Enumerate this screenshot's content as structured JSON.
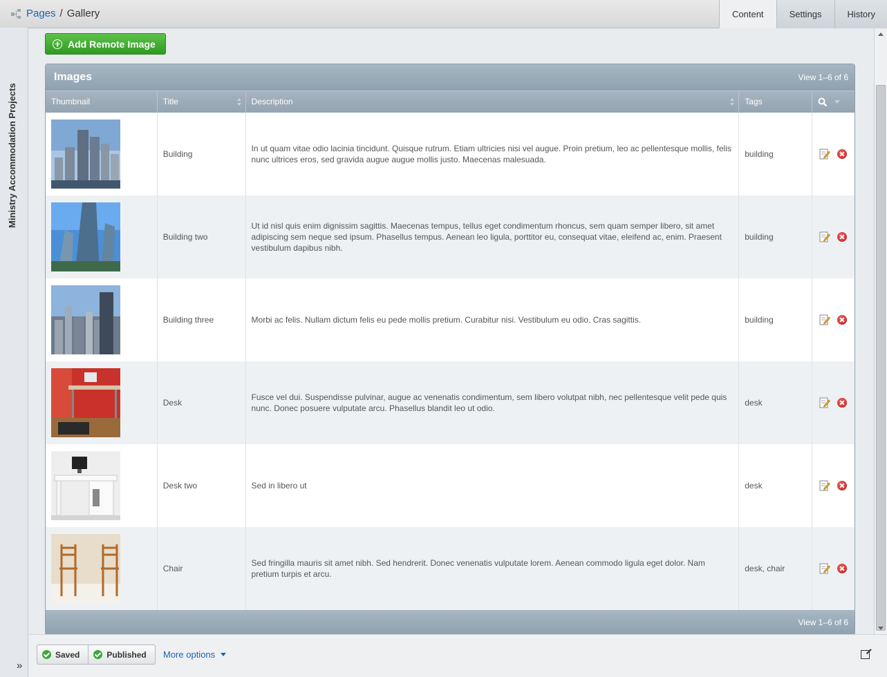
{
  "breadcrumb": {
    "root": "Pages",
    "separator": "/",
    "current": "Gallery"
  },
  "tabs": [
    {
      "label": "Content",
      "active": true
    },
    {
      "label": "Settings",
      "active": false
    },
    {
      "label": "History",
      "active": false
    }
  ],
  "sidebar": {
    "title": "Ministry Accommodation Projects",
    "expand_label": "»"
  },
  "toolbar": {
    "add_label": "Add Remote Image"
  },
  "grid": {
    "title": "Images",
    "view_top": "View 1–6 of 6",
    "view_bottom": "View 1–6 of 6",
    "columns": [
      "Thumbnail",
      "Title",
      "Description",
      "Tags"
    ],
    "rows": [
      {
        "title": "Building",
        "description": "In ut quam vitae odio lacinia tincidunt. Quisque rutrum. Etiam ultricies nisi vel augue. Proin pretium, leo ac pellentesque mollis, felis nunc ultrices eros, sed gravida augue augue mollis justo. Maecenas malesuada.",
        "tags": "building",
        "thumb": "skyscrapers"
      },
      {
        "title": "Building two",
        "description": "Ut id nisl quis enim dignissim sagittis. Maecenas tempus, tellus eget condimentum rhoncus, sem quam semper libero, sit amet adipiscing sem neque sed ipsum. Phasellus tempus. Aenean leo ligula, porttitor eu, consequat vitae, eleifend ac, enim. Praesent vestibulum dapibus nibh.",
        "tags": "building",
        "thumb": "glass-tower"
      },
      {
        "title": "Building three",
        "description": "Morbi ac felis. Nullam dictum felis eu pede mollis pretium. Curabitur nisi. Vestibulum eu odio. Cras sagittis.",
        "tags": "building",
        "thumb": "city-skyline"
      },
      {
        "title": "Desk",
        "description": "Fusce vel dui. Suspendisse pulvinar, augue ac venenatis condimentum, sem libero volutpat nibh, nec pellentesque velit pede quis nunc. Donec posuere vulputate arcu. Phasellus blandit leo ut odio.",
        "tags": "desk",
        "thumb": "red-desk"
      },
      {
        "title": "Desk two",
        "description": "Sed in libero ut",
        "tags": "desk",
        "thumb": "white-desk"
      },
      {
        "title": "Chair",
        "description": "Sed fringilla mauris sit amet nibh. Sed hendrerit. Donec venenatis vulputate lorem. Aenean commodo ligula eget dolor. Nam pretium turpis et arcu.",
        "tags": "desk, chair",
        "thumb": "wooden-chairs"
      }
    ]
  },
  "footer": {
    "saved_label": "Saved",
    "published_label": "Published",
    "more_label": "More options"
  }
}
